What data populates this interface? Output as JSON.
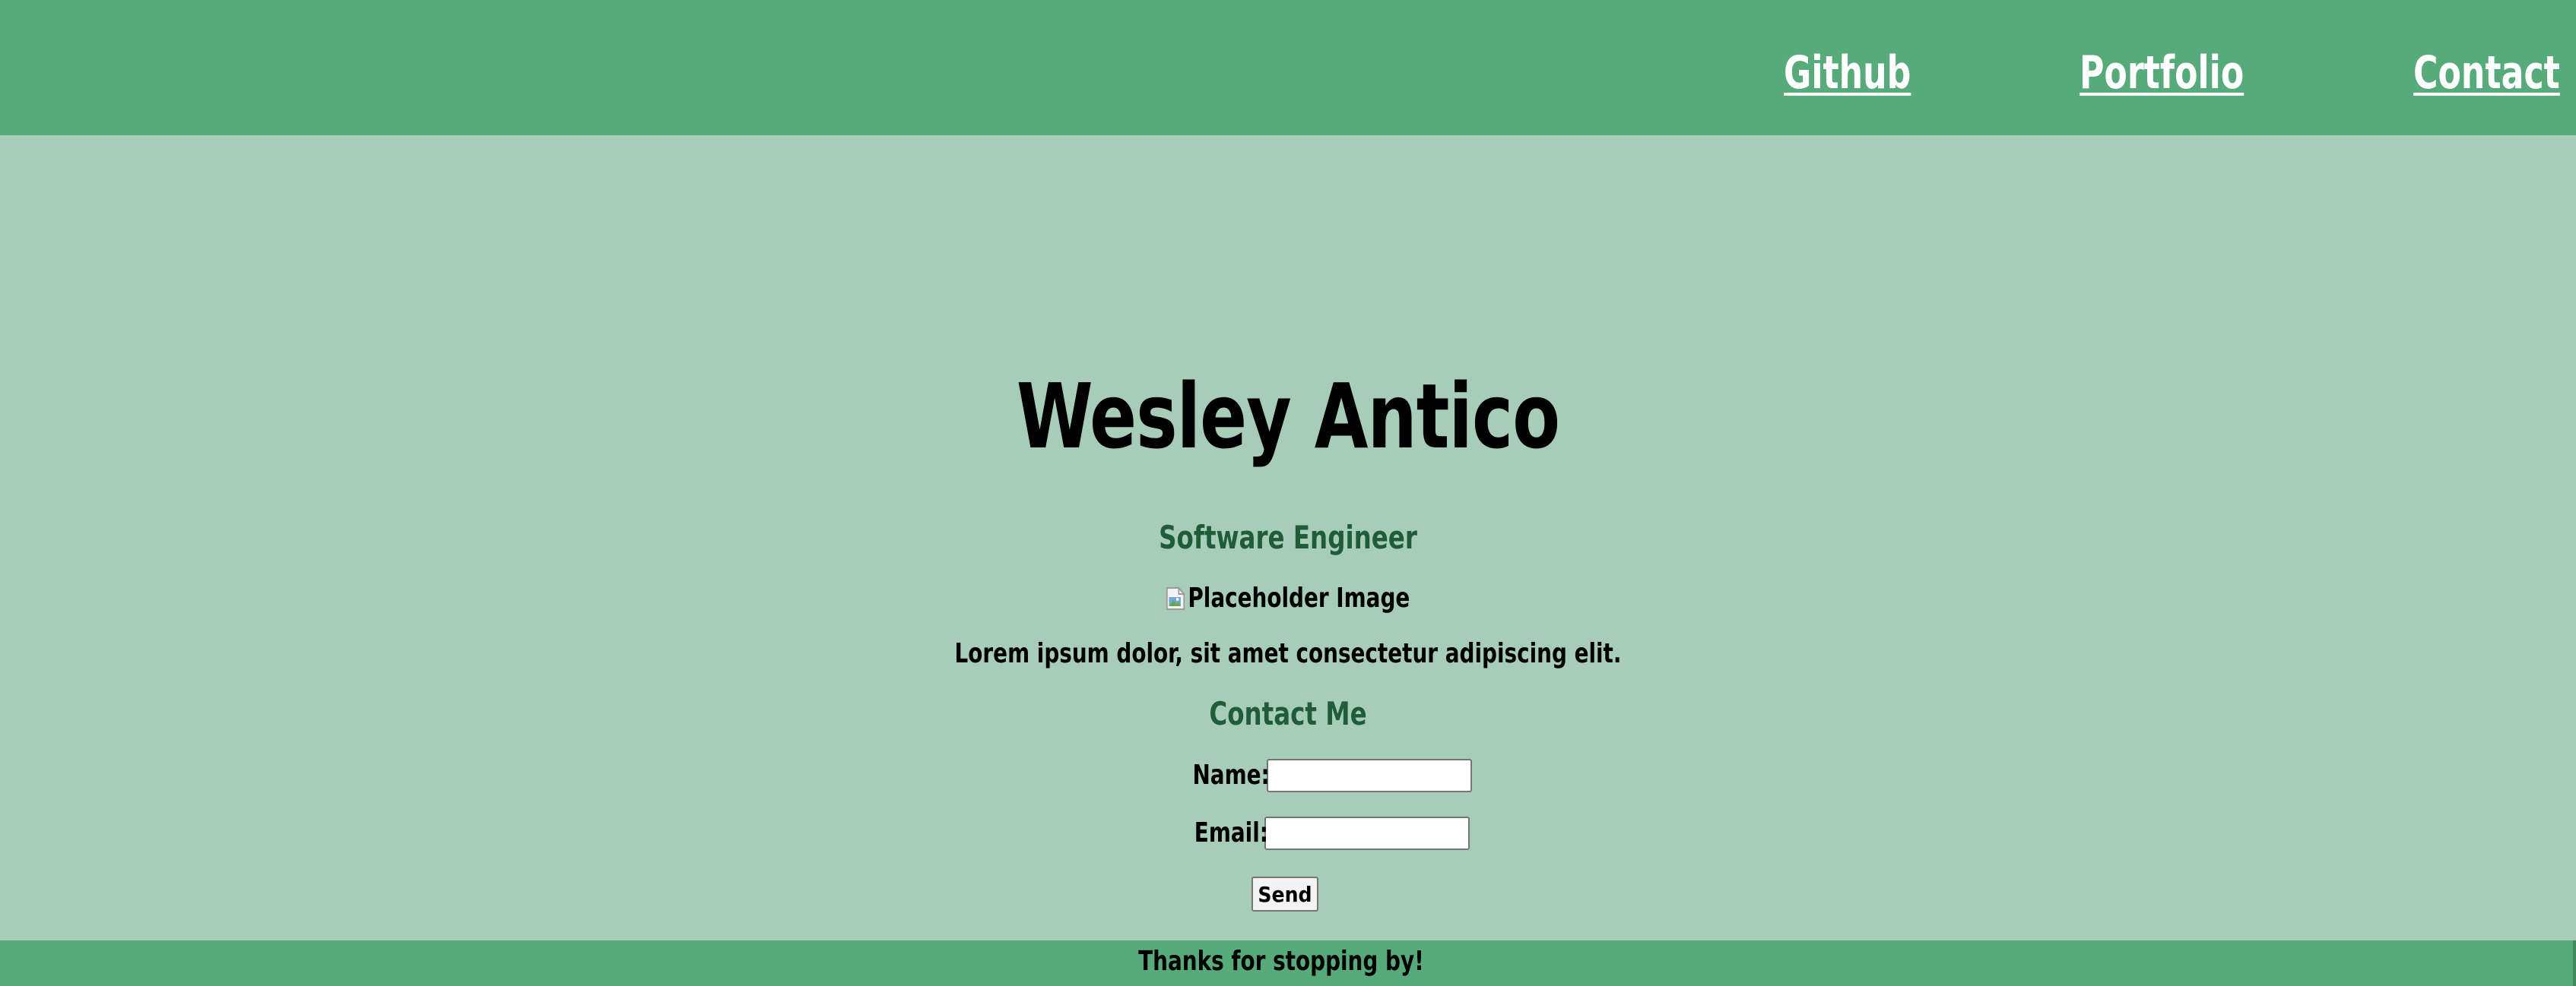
{
  "header": {
    "nav": {
      "github": "Github",
      "portfolio": "Portfolio",
      "contact": "Contact"
    }
  },
  "main": {
    "name": "Wesley Antico",
    "subtitle": "Software Engineer",
    "image_alt": "Placeholder Image",
    "intro": "Lorem ipsum dolor, sit amet consectetur adipiscing elit.",
    "contact_heading": "Contact Me"
  },
  "form": {
    "name_label": "Name:",
    "name_value": "",
    "email_label": "Email:",
    "email_value": "",
    "send_label": "Send"
  },
  "footer": {
    "text": "Thanks for stopping by!"
  },
  "colors": {
    "header_bg": "#57ab7b",
    "page_bg": "#a7cdb9",
    "accent_text": "#1f5c3a",
    "nav_text": "#ffffff"
  },
  "icons": {
    "broken_image": "broken-image-icon"
  }
}
